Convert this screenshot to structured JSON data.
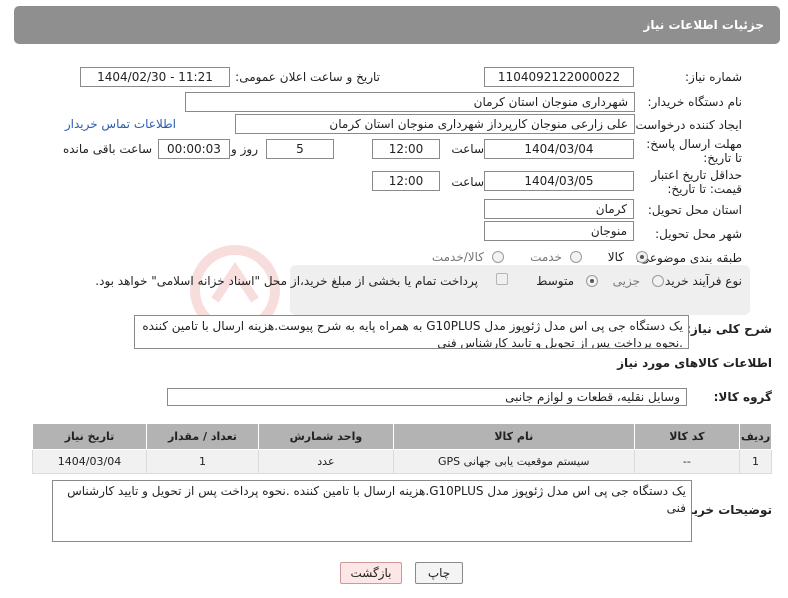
{
  "header": {
    "title": "جزئیات اطلاعات نیاز"
  },
  "form": {
    "need_number_label": "شماره نیاز:",
    "need_number": "1104092122000022",
    "announce_label": "تاریخ و ساعت اعلان عمومی:",
    "announce_value": "1404/02/30 - 11:21",
    "buyer_org_label": "نام دستگاه خریدار:",
    "buyer_org": "شهرداری منوجان استان کرمان",
    "requester_label": "ایجاد کننده درخواست:",
    "requester": "علی زارعی منوجان کارپرداز شهرداری منوجان استان کرمان",
    "contact_link": "اطلاعات تماس خریدار",
    "reply_deadline_label": "مهلت ارسال پاسخ: تا تاریخ:",
    "reply_date": "1404/03/04",
    "time_label": "ساعت",
    "reply_time": "12:00",
    "days_value": "5",
    "days_label": "روز و",
    "remaining_time": "00:00:03",
    "remaining_label": "ساعت باقی مانده",
    "price_validity_label": "حداقل تاریخ اعتبار قیمت: تا تاریخ:",
    "validity_date": "1404/03/05",
    "validity_time": "12:00",
    "province_label": "استان محل تحویل:",
    "province": "کرمان",
    "city_label": "شهر محل تحویل:",
    "city": "منوجان",
    "category_label": "طبقه بندی موضوعی:",
    "category_options": [
      "کالا",
      "خدمت",
      "کالا/خدمت"
    ],
    "process_label": "نوع فرآیند خرید :",
    "process_options": [
      "جزیی",
      "متوسط"
    ],
    "payment_note": "پرداخت تمام یا بخشی از مبلغ خرید،از محل \"اسناد خزانه اسلامی\" خواهد بود.",
    "general_desc_label": "شرح کلی نیاز:",
    "general_desc": "یک دستگاه جی پی اس مدل ژئوپوز مدل G10PLUS به همراه پایه به شرح پیوست.هزینه ارسال با تامین کننده .نحوه پرداخت پس از تحویل و تایید کارشناس فنی"
  },
  "goods": {
    "section_title": "اطلاعات کالاهای مورد نیاز",
    "group_label": "گروه کالا:",
    "group_value": "وسایل نقلیه، قطعات و لوازم جانبی",
    "table": {
      "headers": [
        "ردیف",
        "کد کالا",
        "نام کالا",
        "واحد شمارش",
        "تعداد / مقدار",
        "تاریخ نیاز"
      ],
      "rows": [
        [
          "1",
          "--",
          "سیستم موقعیت یابی جهانی GPS",
          "عدد",
          "1",
          "1404/03/04"
        ]
      ]
    },
    "buyer_desc_label": "توضیحات خریدار:",
    "buyer_desc": "یک دستگاه جی پی اس مدل ژئوپوز مدل G10PLUS.هزینه ارسال با تامین کننده .نحوه پرداخت پس از تحویل و تایید کارشناس فنی"
  },
  "buttons": {
    "print": "چاپ",
    "back": "بازگشت"
  },
  "colors": {
    "header_bg": "#8f8f8f",
    "table_header_bg": "#b3b3b3",
    "link": "#2a5db0",
    "back_button_bg": "#fde6e6"
  }
}
